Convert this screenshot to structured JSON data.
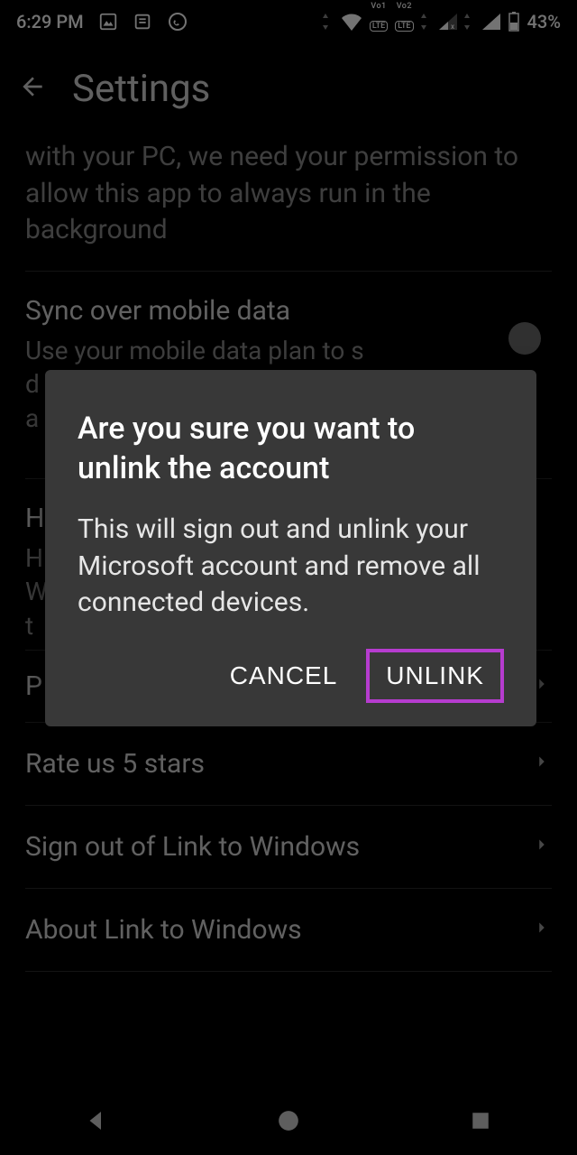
{
  "status": {
    "time": "6:29 PM",
    "battery": "43%"
  },
  "header": {
    "title": "Settings"
  },
  "background_fragment_top": "with your PC, we need your permission to allow this app to always run in the background",
  "sync": {
    "title": "Sync over mobile data",
    "sub": "Use your mobile data plan to s\nd\na"
  },
  "help_frag": {
    "title": "H",
    "sub": "H\nW\nt"
  },
  "feedback_frag": "P",
  "rows": {
    "rate": "Rate us 5 stars",
    "signout": "Sign out of Link to Windows",
    "about": "About Link to Windows"
  },
  "dialog": {
    "title": "Are you sure you want to unlink the account",
    "body": "This will sign out and unlink your Microsoft account and remove all connected devices.",
    "cancel": "CANCEL",
    "unlink": "UNLINK"
  }
}
